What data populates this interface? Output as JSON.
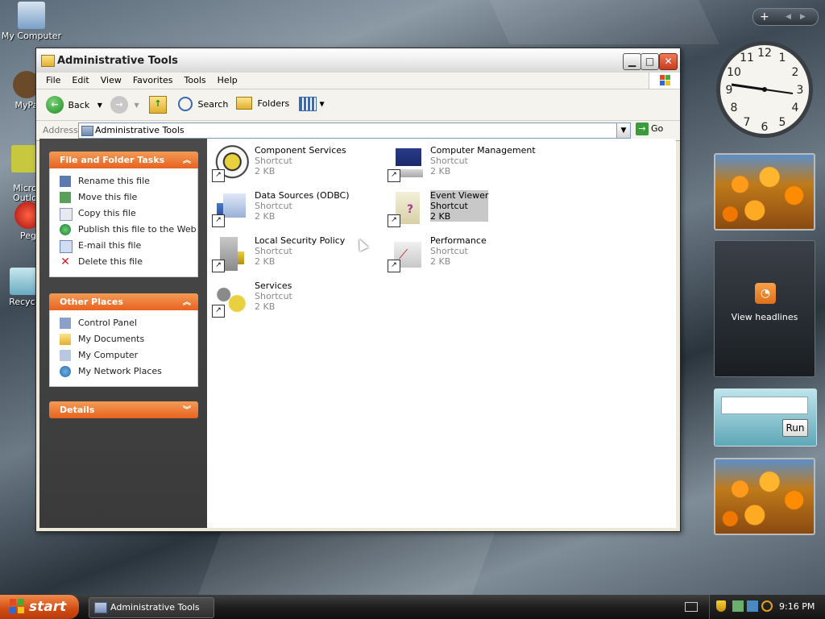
{
  "desktop": {
    "icons": [
      {
        "label": "My Computer"
      },
      {
        "label": "MyPa"
      },
      {
        "label": "Micro\nOutlo"
      },
      {
        "label": "Peg"
      },
      {
        "label": "Recycl"
      }
    ]
  },
  "window": {
    "title": "Administrative Tools",
    "menu": [
      "File",
      "Edit",
      "View",
      "Favorites",
      "Tools",
      "Help"
    ],
    "toolbar": {
      "back": "Back",
      "search": "Search",
      "folders": "Folders"
    },
    "address": {
      "label": "Address",
      "value": "Administrative Tools",
      "go": "Go"
    },
    "file_tasks": {
      "title": "File and Folder Tasks",
      "items": [
        "Rename this file",
        "Move this file",
        "Copy this file",
        "Publish this file to the Web",
        "E-mail this file",
        "Delete this file"
      ]
    },
    "other_places": {
      "title": "Other Places",
      "items": [
        "Control Panel",
        "My Documents",
        "My Computer",
        "My Network Places"
      ]
    },
    "details": {
      "title": "Details"
    },
    "files": [
      {
        "name": "Component Services",
        "type": "Shortcut",
        "size": "2 KB"
      },
      {
        "name": "Computer Management",
        "type": "Shortcut",
        "size": "2 KB"
      },
      {
        "name": "Data Sources (ODBC)",
        "type": "Shortcut",
        "size": "2 KB"
      },
      {
        "name": "Event Viewer",
        "type": "Shortcut",
        "size": "2 KB"
      },
      {
        "name": "Local Security Policy",
        "type": "Shortcut",
        "size": "2 KB"
      },
      {
        "name": "Performance",
        "type": "Shortcut",
        "size": "2 KB"
      },
      {
        "name": "Services",
        "type": "Shortcut",
        "size": "2 KB"
      }
    ]
  },
  "sidebar": {
    "clock": {
      "numbers": [
        "12",
        "1",
        "2",
        "3",
        "4",
        "5",
        "6",
        "7",
        "8",
        "9",
        "10",
        "11"
      ]
    },
    "headlines": {
      "label": "View headlines"
    },
    "run": {
      "button": "Run"
    }
  },
  "taskbar": {
    "start": "start",
    "task": "Administrative Tools",
    "time": "9:16 PM"
  }
}
